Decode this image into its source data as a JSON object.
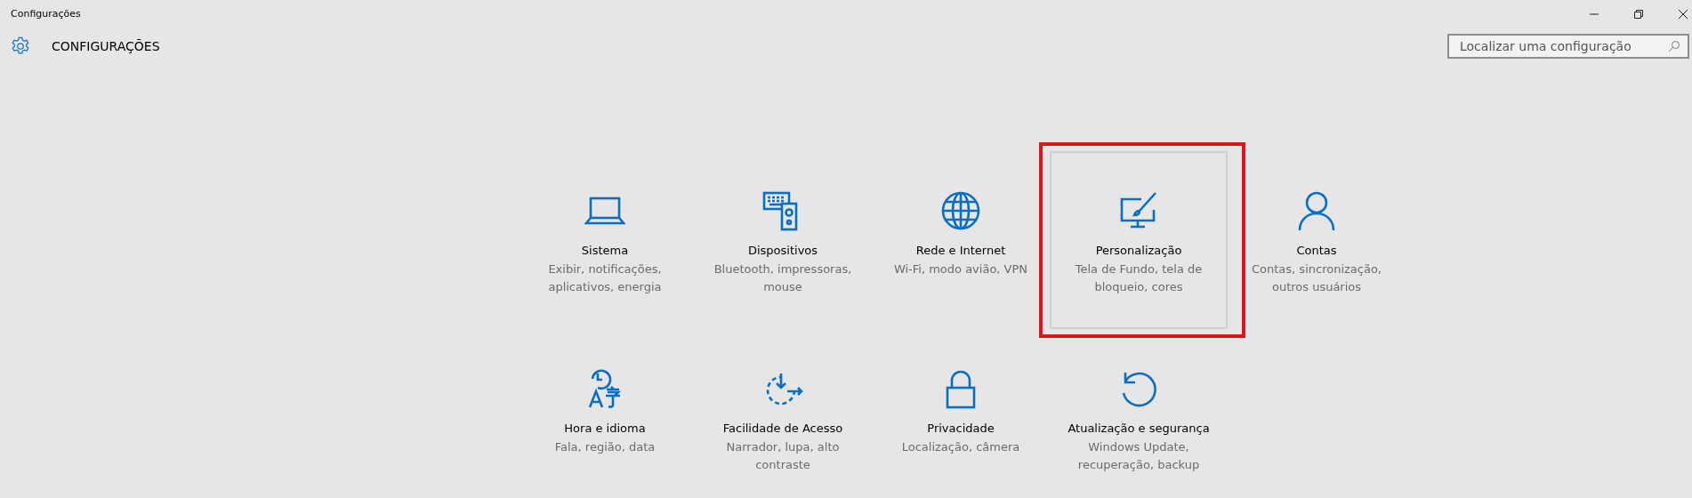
{
  "window": {
    "title": "Configurações"
  },
  "header": {
    "title": "CONFIGURAÇÕES"
  },
  "search": {
    "placeholder": "Localizar uma configuração"
  },
  "tiles": [
    {
      "title": "Sistema",
      "description": "Exibir, notificações, aplicativos, energia",
      "highlighted": false
    },
    {
      "title": "Dispositivos",
      "description": "Bluetooth, impressoras, mouse",
      "highlighted": false
    },
    {
      "title": "Rede e Internet",
      "description": "Wi-Fi, modo avião, VPN",
      "highlighted": false
    },
    {
      "title": "Personalização",
      "description": "Tela de Fundo, tela de bloqueio, cores",
      "highlighted": true
    },
    {
      "title": "Contas",
      "description": "Contas, sincronização, outros usuários",
      "highlighted": false
    },
    {
      "title": "Hora e idioma",
      "description": "Fala, região, data",
      "highlighted": false
    },
    {
      "title": "Facilidade de Acesso",
      "description": "Narrador, lupa, alto contraste",
      "highlighted": false
    },
    {
      "title": "Privacidade",
      "description": "Localização, câmera",
      "highlighted": false
    },
    {
      "title": "Atualização e segurança",
      "description": "Windows Update, recuperação, backup",
      "highlighted": false
    }
  ]
}
